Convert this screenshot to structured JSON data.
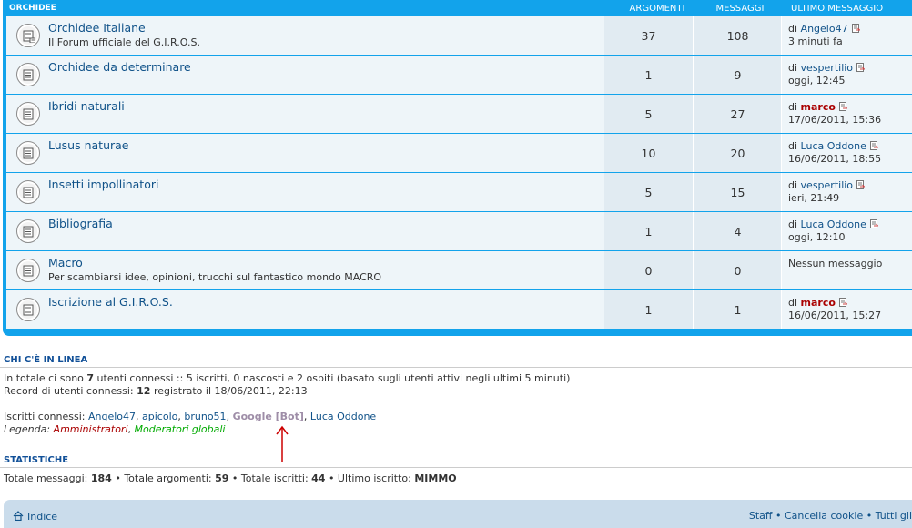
{
  "forum_list": {
    "header": {
      "category": "ORCHIDEE",
      "topics": "ARGOMENTI",
      "posts": "MESSAGGI",
      "last_post": "ULTIMO MESSAGGIO"
    },
    "rows": [
      {
        "title": "Orchidee Italiane",
        "description": "Il Forum ufficiale del G.I.R.O.S.",
        "topics": "37",
        "posts": "108",
        "by": "di",
        "author": "Angelo47",
        "when": "3 minuti fa",
        "icon": "forum-subforum-icon"
      },
      {
        "title": "Orchidee da determinare",
        "description": "",
        "topics": "1",
        "posts": "9",
        "by": "di",
        "author": "vespertilio",
        "when": "oggi, 12:45",
        "icon": "forum-read-icon"
      },
      {
        "title": "Ibridi naturali",
        "description": "",
        "topics": "5",
        "posts": "27",
        "by": "di",
        "author": "marco",
        "when": "17/06/2011, 15:36",
        "icon": "forum-read-icon"
      },
      {
        "title": "Lusus naturae",
        "description": "",
        "topics": "10",
        "posts": "20",
        "by": "di",
        "author": "Luca Oddone",
        "when": "16/06/2011, 18:55",
        "icon": "forum-read-icon"
      },
      {
        "title": "Insetti impollinatori",
        "description": "",
        "topics": "5",
        "posts": "15",
        "by": "di",
        "author": "vespertilio",
        "when": "ieri, 21:49",
        "icon": "forum-read-icon"
      },
      {
        "title": "Bibliografia",
        "description": "",
        "topics": "1",
        "posts": "4",
        "by": "di",
        "author": "Luca Oddone",
        "when": "oggi, 12:10",
        "icon": "forum-read-icon"
      },
      {
        "title": "Macro",
        "description": "Per scambiarsi idee, opinioni, trucchi sul fantastico mondo MACRO",
        "topics": "0",
        "posts": "0",
        "no_posts": "Nessun messaggio",
        "icon": "forum-read-icon"
      },
      {
        "title": "Iscrizione al G.I.R.O.S.",
        "description": "",
        "topics": "1",
        "posts": "1",
        "by": "di",
        "author": "marco",
        "when": "16/06/2011, 15:27",
        "icon": "forum-read-icon"
      }
    ]
  },
  "online": {
    "title": "CHI C'È IN LINEA",
    "line1_pre": "In totale ci sono ",
    "line1_count": "7",
    "line1_post": " utenti connessi :: 5 iscritti, 0 nascosti e 2 ospiti (basato sugli utenti attivi negli ultimi 5 minuti)",
    "record_pre": "Record di utenti connessi: ",
    "record_count": "12",
    "record_post": " registrato il 18/06/2011, 22:13",
    "registered_label": "Iscritti connessi: ",
    "users": [
      "Angelo47",
      "apicolo",
      "bruno51"
    ],
    "bot": "Google [Bot]",
    "last_user": "Luca Oddone",
    "legend_label": "Legenda: ",
    "legend_admin": "Amministratori",
    "legend_mod": "Moderatori globali"
  },
  "stats": {
    "title": "STATISTICHE",
    "posts_label": "Totale messaggi: ",
    "posts": "184",
    "topics_label": " • Totale argomenti: ",
    "topics": "59",
    "members_label": " • Totale iscritti: ",
    "members": "44",
    "newest_label": " • Ultimo iscritto: ",
    "newest": "MIMMO"
  },
  "footer": {
    "home": "Indice",
    "staff": "Staff",
    "cookies": "Cancella cookie",
    "all": "Tutti gli"
  },
  "colors": {
    "header_blue": "#12a3eb",
    "link": "#105289",
    "admin": "#aa0000",
    "mod": "#00aa00",
    "bot": "#9e8da7",
    "annotation_arrow": "#cc0000"
  }
}
